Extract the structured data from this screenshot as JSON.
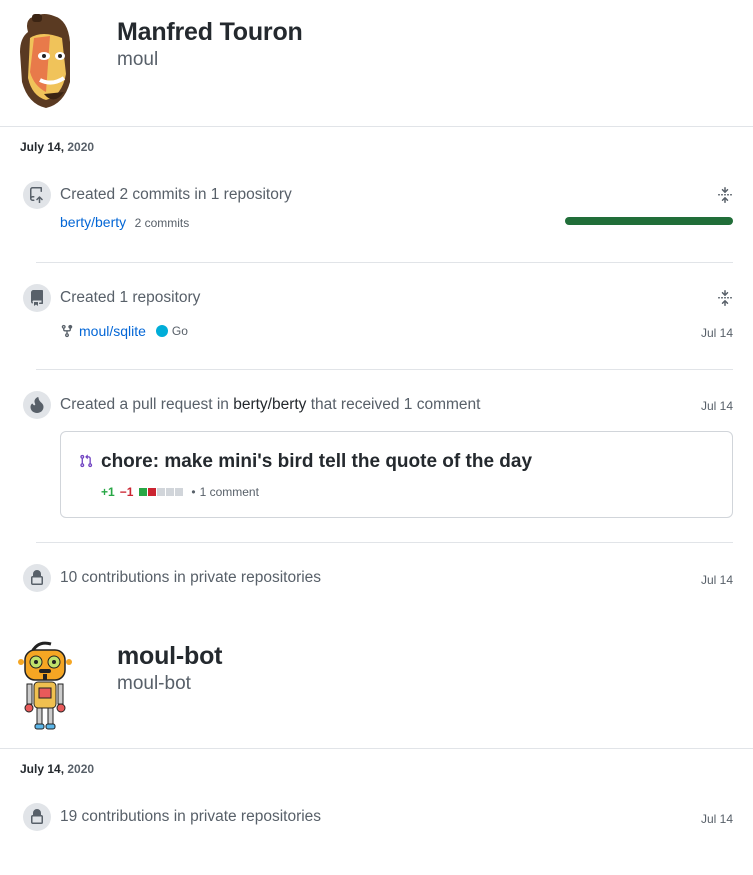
{
  "profiles": [
    {
      "name": "Manfred Touron",
      "login": "moul",
      "date_month_day": "July 14,",
      "date_year": "2020",
      "events": [
        {
          "type": "commits",
          "icon": "repo-push-icon",
          "title": "Created 2 commits in 1 repository",
          "repo": "berty/berty",
          "detail": "2 commits",
          "progress_fraction": 1.0
        },
        {
          "type": "repo",
          "icon": "repo-icon",
          "title": "Created 1 repository",
          "repo": "moul/sqlite",
          "language": "Go",
          "language_color": "#00ADD8",
          "date": "Jul 14"
        },
        {
          "type": "pr",
          "icon": "flame-icon",
          "title_prefix": "Created a pull request in",
          "title_repo": "berty/berty",
          "title_suffix": "that received 1 comment",
          "date": "Jul 14",
          "pr_title": "chore: make mini's bird tell the quote of the day",
          "additions": "+1",
          "deletions": "−1",
          "comments": "1 comment"
        },
        {
          "type": "private",
          "icon": "lock-icon",
          "title": "10 contributions in private repositories",
          "date": "Jul 14"
        }
      ]
    },
    {
      "name": "moul-bot",
      "login": "moul-bot",
      "date_month_day": "July 14,",
      "date_year": "2020",
      "events": [
        {
          "type": "private",
          "icon": "lock-icon",
          "title": "19 contributions in private repositories",
          "date": "Jul 14"
        }
      ]
    }
  ],
  "colors": {
    "link": "#0366d6",
    "bar": "#216e39",
    "additions": "#28a745",
    "deletions": "#cb2431",
    "go": "#00ADD8"
  }
}
